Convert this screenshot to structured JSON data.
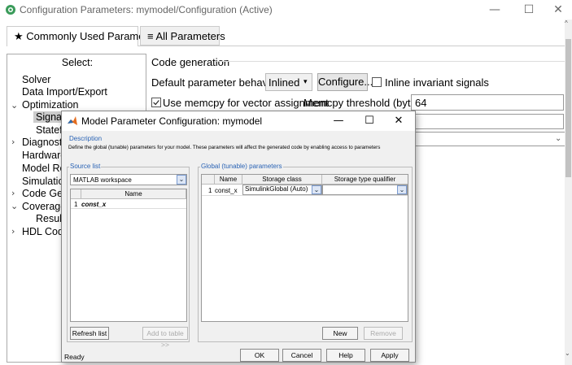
{
  "window": {
    "title": "Configuration Parameters: mymodel/Configuration (Active)",
    "minimize": "—",
    "maximize": "☐",
    "close": "✕"
  },
  "tabs": [
    {
      "label": "★ Commonly Used Parameters"
    },
    {
      "label": "≡ All Parameters"
    }
  ],
  "tree": {
    "header": "Select:",
    "items": [
      {
        "label": "Solver"
      },
      {
        "label": "Data Import/Export"
      },
      {
        "label": "Optimization"
      },
      {
        "label": "Signals"
      },
      {
        "label": "Statefl"
      },
      {
        "label": "Diagnostic"
      },
      {
        "label": "Hardware"
      },
      {
        "label": "Model Refe"
      },
      {
        "label": "Simulation"
      },
      {
        "label": "Code Gene"
      },
      {
        "label": "Coverage"
      },
      {
        "label": "Results"
      },
      {
        "label": "HDL Code"
      }
    ],
    "expanders": {
      "collapsed": "›",
      "expanded": "⌄"
    }
  },
  "code_generation": {
    "heading": "Code generation",
    "default_behavior_label": "Default parameter behavior:",
    "default_behavior_value": "Inlined",
    "configure_label": "Configure...",
    "inline_invariant_label": "Inline invariant signals",
    "memcpy_label": "Use memcpy for vector assignment",
    "memcpy_threshold_label": "Memcpy threshold (bytes):",
    "memcpy_threshold_value": "64"
  },
  "dialog": {
    "title": "Model Parameter Configuration: mymodel",
    "description_label": "Description",
    "description_text": "Define the global (tunable) parameters for your model. These parameters will affect the generated code by enabling access to parameters",
    "source_list_label": "Source list",
    "source_select": "MATLAB workspace",
    "source_table_header": "Name",
    "source_rows": [
      {
        "index": "1",
        "name": "const_x"
      }
    ],
    "refresh_label": "Refresh list",
    "add_to_table_label": "Add to table >>",
    "global_label": "Global (tunable) parameters",
    "global_headers": {
      "name": "Name",
      "storage_class": "Storage class",
      "qualifier": "Storage type qualifier"
    },
    "global_rows": [
      {
        "index": "1",
        "name": "const_x",
        "storage_class": "SimulinkGlobal (Auto)",
        "qualifier": ""
      }
    ],
    "new_label": "New",
    "remove_label": "Remove",
    "status": "Ready",
    "ok_label": "OK",
    "cancel_label": "Cancel",
    "help_label": "Help",
    "apply_label": "Apply",
    "minimize": "—",
    "maximize": "☐",
    "close": "✕"
  },
  "colors": {
    "group_label": "#2962b4",
    "matlab_icon": "#e36c1f"
  }
}
